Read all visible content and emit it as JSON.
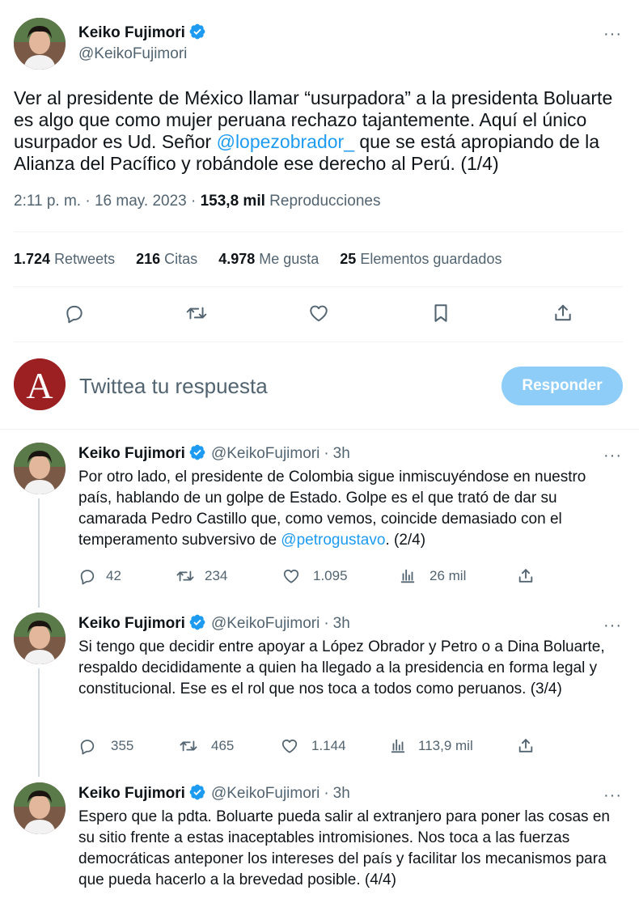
{
  "main_tweet": {
    "author_name": "Keiko Fujimori",
    "author_handle": "@KeikoFujimori",
    "text_part1": "Ver al presidente de México llamar “usurpadora” a la presidenta Boluarte es algo que como mujer peruana rechazo tajantemente. Aquí el único usurpador es Ud. Señor ",
    "mention": "@lopezobrador_",
    "text_part2": " que se está apropiando de la Alianza del Pacífico y robándole ese derecho al Perú. (1/4)",
    "time": "2:11 p. m.",
    "date": "16 may. 2023",
    "views_count": "153,8 mil",
    "views_label": "Reproducciones",
    "stats": [
      {
        "count": "1.724",
        "label": "Retweets"
      },
      {
        "count": "216",
        "label": "Citas"
      },
      {
        "count": "4.978",
        "label": "Me gusta"
      },
      {
        "count": "25",
        "label": "Elementos guardados"
      }
    ]
  },
  "icons": {
    "verified": "verified-badge-icon",
    "reply": "reply-icon",
    "retweet": "retweet-icon",
    "like": "heart-icon",
    "bookmark": "bookmark-icon",
    "share": "share-icon",
    "views": "analytics-icon",
    "more": "more-icon"
  },
  "colors": {
    "link": "#1d9bf0",
    "verified": "#1d9bf0",
    "reply_button": "#8ecdf8",
    "muted_text": "#536471"
  },
  "compose": {
    "placeholder": "Twittea tu respuesta",
    "button_label": "Responder",
    "avatar_letter": "A"
  },
  "more_label": "···",
  "thread": [
    {
      "name": "Keiko Fujimori",
      "handle": "@KeikoFujimori",
      "dot": "·",
      "time": "3h",
      "text_part1": "Por otro lado, el presidente de Colombia sigue inmiscuyéndose en nuestro país, hablando de un golpe de Estado. Golpe es el que trató de dar su camarada Pedro Castillo que, como vemos, coincide demasiado con el temperamento subversivo de ",
      "mention": "@petrogustavo",
      "text_part2": ". (2/4)",
      "replies": "42",
      "retweets": "234",
      "likes": "1.095",
      "views": "26 mil"
    },
    {
      "name": "Keiko Fujimori",
      "handle": "@KeikoFujimori",
      "dot": "·",
      "time": "3h",
      "text_part1": "Si tengo que decidir entre apoyar a López Obrador y Petro o a Dina Boluarte, respaldo decididamente a quien ha llegado a la presidencia en forma legal y constitucional. Ese es el rol que nos toca a todos como peruanos. (3/4)",
      "mention": "",
      "text_part2": "",
      "replies": "355",
      "retweets": "465",
      "likes": "1.144",
      "views": "113,9 mil"
    },
    {
      "name": "Keiko Fujimori",
      "handle": "@KeikoFujimori",
      "dot": "·",
      "time": "3h",
      "text_part1": "Espero que la pdta. Boluarte pueda salir al extranjero para poner las cosas en su sitio frente a estas inaceptables intromisiones. Nos toca a las fuerzas democráticas anteponer los intereses del país y facilitar los mecanismos para que pueda hacerlo a la brevedad posible. (4/4)",
      "mention": "",
      "text_part2": ""
    }
  ]
}
